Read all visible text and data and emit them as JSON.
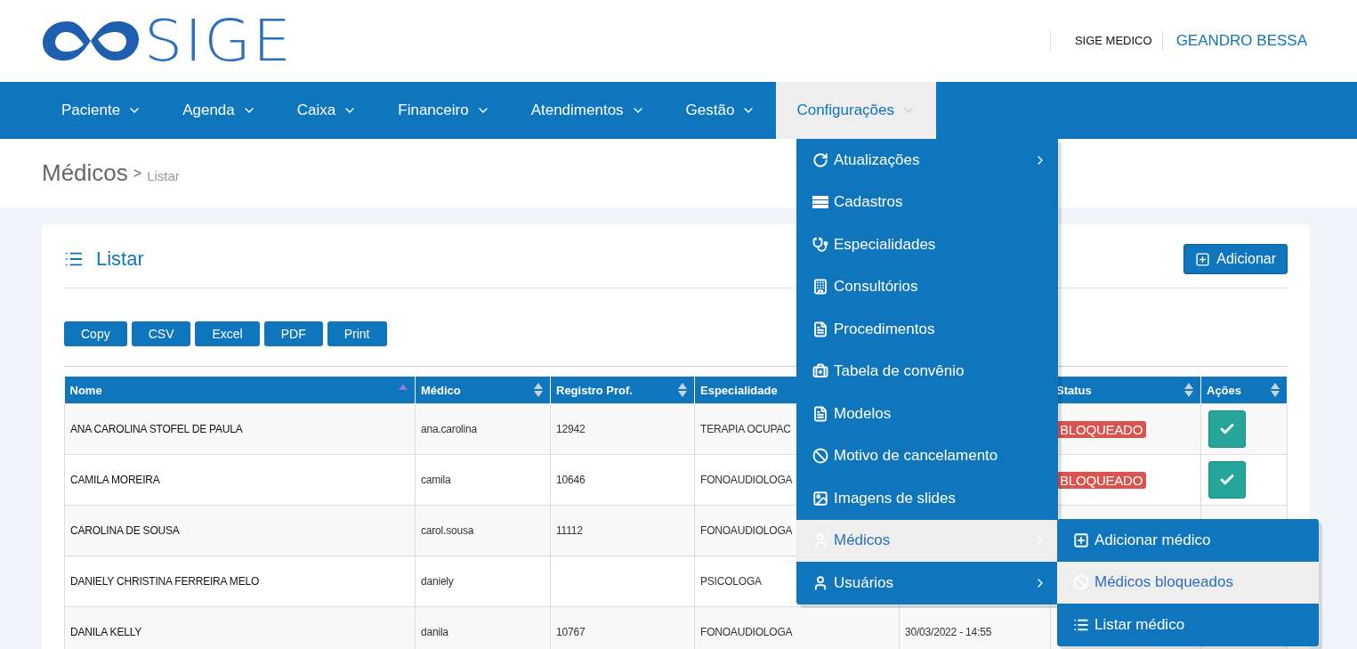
{
  "logo": {
    "text": "SIGE"
  },
  "user_bar": {
    "role": "SIGE MEDICO",
    "user": "GEANDRO BESSA"
  },
  "nav": [
    {
      "label": "Paciente",
      "selected": false
    },
    {
      "label": "Agenda",
      "selected": false
    },
    {
      "label": "Caixa",
      "selected": false
    },
    {
      "label": "Financeiro",
      "selected": false
    },
    {
      "label": "Atendimentos",
      "selected": false
    },
    {
      "label": "Gestão",
      "selected": false
    },
    {
      "label": "Configurações",
      "selected": true
    }
  ],
  "breadcrumb": {
    "title": "Médicos",
    "separator": ">",
    "current": "Listar"
  },
  "card": {
    "title": "Listar",
    "add_button": "Adicionar"
  },
  "export_buttons": [
    "Copy",
    "CSV",
    "Excel",
    "PDF",
    "Print"
  ],
  "table": {
    "columns": [
      {
        "label": "Nome",
        "sorted_ascending": true
      },
      {
        "label": "Médico",
        "sorted_ascending": false
      },
      {
        "label": "Registro Prof.",
        "sorted_ascending": false
      },
      {
        "label": "Especialidade"
      },
      {},
      {
        "label": "Status",
        "sorted_ascending": false
      },
      {
        "label": "Ações",
        "sorted_ascending": false
      }
    ],
    "rows": [
      {
        "nome": "ANA CAROLINA STOFEL DE PAULA",
        "medico": "ana.carolina",
        "registro": "12942",
        "especialidade": "TERAPIA OCUPAC",
        "status": "BLOQUEADO",
        "approve_action": true
      },
      {
        "nome": "CAMILA MOREIRA",
        "medico": "camila",
        "registro": "10646",
        "especialidade": "FONOAUDIOLOGA",
        "status": "BLOQUEADO",
        "approve_action": true
      },
      {
        "nome": "CAROLINA DE SOUSA",
        "medico": "carol.sousa",
        "registro": "11112",
        "especialidade": "FONOAUDIOLOGA",
        "approve_action": false
      },
      {
        "nome": "DANIELY CHRISTINA FERREIRA MELO",
        "medico": "daniely",
        "especialidade": "PSICOLOGA",
        "approve_action": false
      },
      {
        "nome": "DANILA KELLY",
        "medico": "danila",
        "registro": "10767",
        "especialidade": "FONOAUDIOLOGA",
        "column_5": "30/03/2022 - 14:55",
        "approve_action": false
      }
    ]
  },
  "dropdown": {
    "items": [
      {
        "label": "Atualizações",
        "submenu": true,
        "selected": false
      },
      {
        "label": "Cadastros",
        "submenu": false,
        "selected": false
      },
      {
        "label": "Especialidades",
        "submenu": false,
        "selected": false
      },
      {
        "label": "Consultórios",
        "submenu": false,
        "selected": false
      },
      {
        "label": "Procedimentos",
        "submenu": false,
        "selected": false
      },
      {
        "label": "Tabela de convênio",
        "submenu": false,
        "selected": false
      },
      {
        "label": "Modelos",
        "submenu": false,
        "selected": false
      },
      {
        "label": "Motivo de cancelamento",
        "submenu": false,
        "selected": false
      },
      {
        "label": "Imagens de slides",
        "submenu": false,
        "selected": false
      },
      {
        "label": "Médicos",
        "submenu": true,
        "selected": true
      },
      {
        "label": "Usuários",
        "submenu": true,
        "selected": false
      }
    ]
  },
  "submenu": {
    "items": [
      {
        "label": "Adicionar médico",
        "selected": false
      },
      {
        "label": "Médicos bloqueados",
        "selected": true
      },
      {
        "label": "Listar médico",
        "selected": false
      }
    ]
  }
}
